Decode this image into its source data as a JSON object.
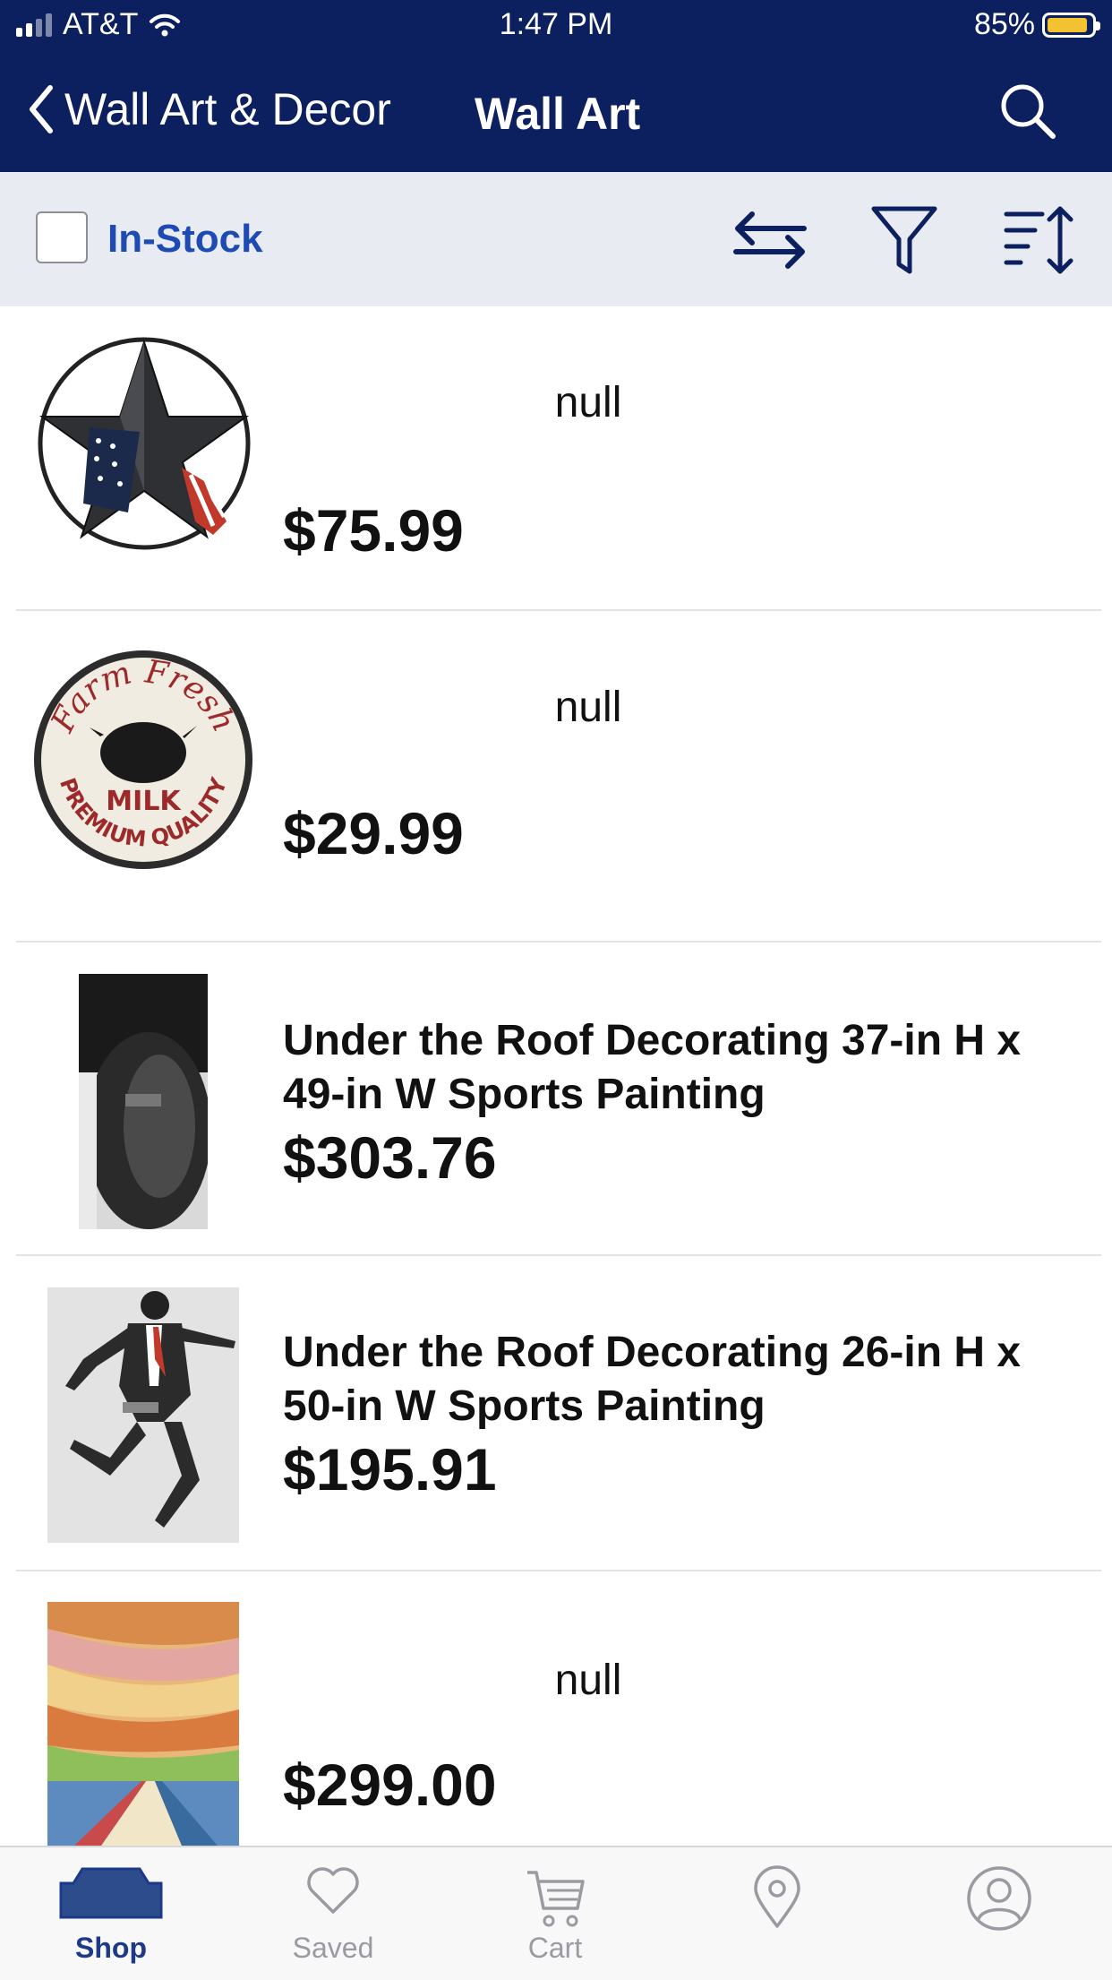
{
  "status_bar": {
    "carrier": "AT&T",
    "time": "1:47 PM",
    "battery": "85%"
  },
  "nav": {
    "back_label": "Wall Art & Decor",
    "title": "Wall Art"
  },
  "filter": {
    "in_stock_label": "In-Stock",
    "in_stock_checked": false
  },
  "products": [
    {
      "name": "null",
      "price": "$75.99",
      "image": "barn-star-flag-icon"
    },
    {
      "name": "null",
      "price": "$29.99",
      "image": "farm-fresh-milk-sign-icon",
      "sign_text": {
        "top": "Farm Fresh",
        "middle": "MILK",
        "bottom": "PREMIUM QUALITY"
      }
    },
    {
      "name": "Under the Roof Decorating 37-in H x 49-in W Sports Painting",
      "price": "$303.76",
      "image": "sports-painting-bw-icon"
    },
    {
      "name": "Under the Roof Decorating 26-in H x 50-in W Sports Painting",
      "price": "$195.91",
      "image": "jumping-man-painting-icon"
    },
    {
      "name": "null",
      "price": "$299.00",
      "image": "colorful-landscape-painting-icon"
    }
  ],
  "tabs": [
    {
      "label": "Shop",
      "icon": "shop-icon",
      "active": true
    },
    {
      "label": "Saved",
      "icon": "heart-icon",
      "active": false
    },
    {
      "label": "Cart",
      "icon": "cart-icon",
      "active": false
    },
    {
      "label": "",
      "icon": "location-pin-icon",
      "active": false
    },
    {
      "label": "",
      "icon": "account-icon",
      "active": false
    }
  ],
  "colors": {
    "nav_bg": "#0c1f5f",
    "filter_bg": "#e8ecf2",
    "accent": "#1d4bb3",
    "active_tab": "#1d3a8a"
  }
}
